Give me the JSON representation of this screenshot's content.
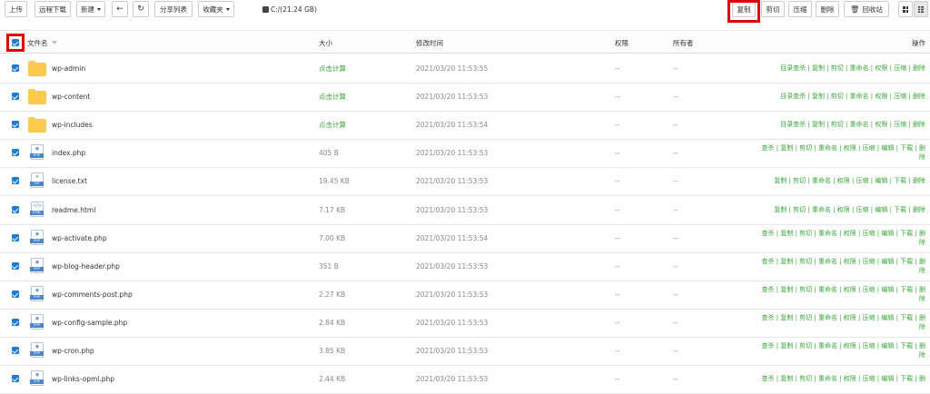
{
  "toolbar": {
    "upload": "上传",
    "remote_download": "远程下载",
    "new": "新建",
    "back_icon": "arrow-left-icon",
    "refresh_icon": "refresh-icon",
    "share_list": "分享列表",
    "favorites": "收藏夹",
    "path": "C:/(21.24 GB)",
    "copy": "复制",
    "cut": "剪切",
    "compress": "压缩",
    "delete": "删除",
    "recycle_bin": "回收站",
    "grid_view_icon": "grid-icon",
    "list_view_icon": "list-icon"
  },
  "table": {
    "headers": {
      "name": "文件名",
      "size": "大小",
      "mtime": "修改时间",
      "perm": "权限",
      "owner": "所有者",
      "ops": "操作"
    },
    "rows": [
      {
        "name": "wp-admin",
        "type": "folder",
        "size": "点击计算",
        "mtime": "2021/03/20 11:53:55",
        "perm": "--",
        "owner": "--",
        "ops1": "目录查杀 | 复制 | 剪切 | 重命名 | 权限 | 压缩 | 删除",
        "ops2": ""
      },
      {
        "name": "wp-content",
        "type": "folder",
        "size": "点击计算",
        "mtime": "2021/03/20 11:53:53",
        "perm": "--",
        "owner": "--",
        "ops1": "目录查杀 | 复制 | 剪切 | 重命名 | 权限 | 压缩 | 删除",
        "ops2": ""
      },
      {
        "name": "wp-includes",
        "type": "folder",
        "size": "点击计算",
        "mtime": "2021/03/20 11:53:54",
        "perm": "--",
        "owner": "--",
        "ops1": "目录查杀 | 复制 | 剪切 | 重命名 | 权限 | 压缩 | 删除",
        "ops2": ""
      },
      {
        "name": "index.php",
        "type": "PHP",
        "size": "405 B",
        "mtime": "2021/03/20 11:53:53",
        "perm": "--",
        "owner": "--",
        "ops1": "查杀 | 复制 | 剪切 | 重命名 | 权限 | 压缩 | 编辑 | 下载 | 删",
        "ops2": "除"
      },
      {
        "name": "license.txt",
        "type": "TXT",
        "size": "19.45 KB",
        "mtime": "2021/03/20 11:53:53",
        "perm": "--",
        "owner": "--",
        "ops1": "复制 | 剪切 | 重命名 | 权限 | 压缩 | 编辑 | 下载 | 删除",
        "ops2": ""
      },
      {
        "name": "readme.html",
        "type": "HTML",
        "size": "7.17 KB",
        "mtime": "2021/03/20 11:53:53",
        "perm": "--",
        "owner": "--",
        "ops1": "复制 | 剪切 | 重命名 | 权限 | 压缩 | 编辑 | 下载 | 删除",
        "ops2": ""
      },
      {
        "name": "wp-activate.php",
        "type": "PHP",
        "size": "7.00 KB",
        "mtime": "2021/03/20 11:53:54",
        "perm": "--",
        "owner": "--",
        "ops1": "查杀 | 复制 | 剪切 | 重命名 | 权限 | 压缩 | 编辑 | 下载 | 删",
        "ops2": "除"
      },
      {
        "name": "wp-blog-header.php",
        "type": "PHP",
        "size": "351 B",
        "mtime": "2021/03/20 11:53:53",
        "perm": "--",
        "owner": "--",
        "ops1": "查杀 | 复制 | 剪切 | 重命名 | 权限 | 压缩 | 编辑 | 下载 | 删",
        "ops2": "除"
      },
      {
        "name": "wp-comments-post.php",
        "type": "PHP",
        "size": "2.27 KB",
        "mtime": "2021/03/20 11:53:53",
        "perm": "--",
        "owner": "--",
        "ops1": "查杀 | 复制 | 剪切 | 重命名 | 权限 | 压缩 | 编辑 | 下载 | 删",
        "ops2": "除"
      },
      {
        "name": "wp-config-sample.php",
        "type": "PHP",
        "size": "2.84 KB",
        "mtime": "2021/03/20 11:53:53",
        "perm": "--",
        "owner": "--",
        "ops1": "查杀 | 复制 | 剪切 | 重命名 | 权限 | 压缩 | 编辑 | 下载 | 删",
        "ops2": "除"
      },
      {
        "name": "wp-cron.php",
        "type": "PHP",
        "size": "3.85 KB",
        "mtime": "2021/03/20 11:53:53",
        "perm": "--",
        "owner": "--",
        "ops1": "查杀 | 复制 | 剪切 | 重命名 | 权限 | 压缩 | 编辑 | 下载 | 删",
        "ops2": "除"
      },
      {
        "name": "wp-links-opml.php",
        "type": "PHP",
        "size": "2.44 KB",
        "mtime": "2021/03/20 11:53:53",
        "perm": "--",
        "owner": "--",
        "ops1": "查杀 | 复制 | 剪切 | 重命名 | 权限 | 压缩 | 编辑 | 下载 | 删",
        "ops2": ""
      }
    ]
  },
  "colors": {
    "accent": "#1e7bd6",
    "action_green": "#3aa63a",
    "highlight": "#e00000",
    "folder": "#fccb4e"
  }
}
